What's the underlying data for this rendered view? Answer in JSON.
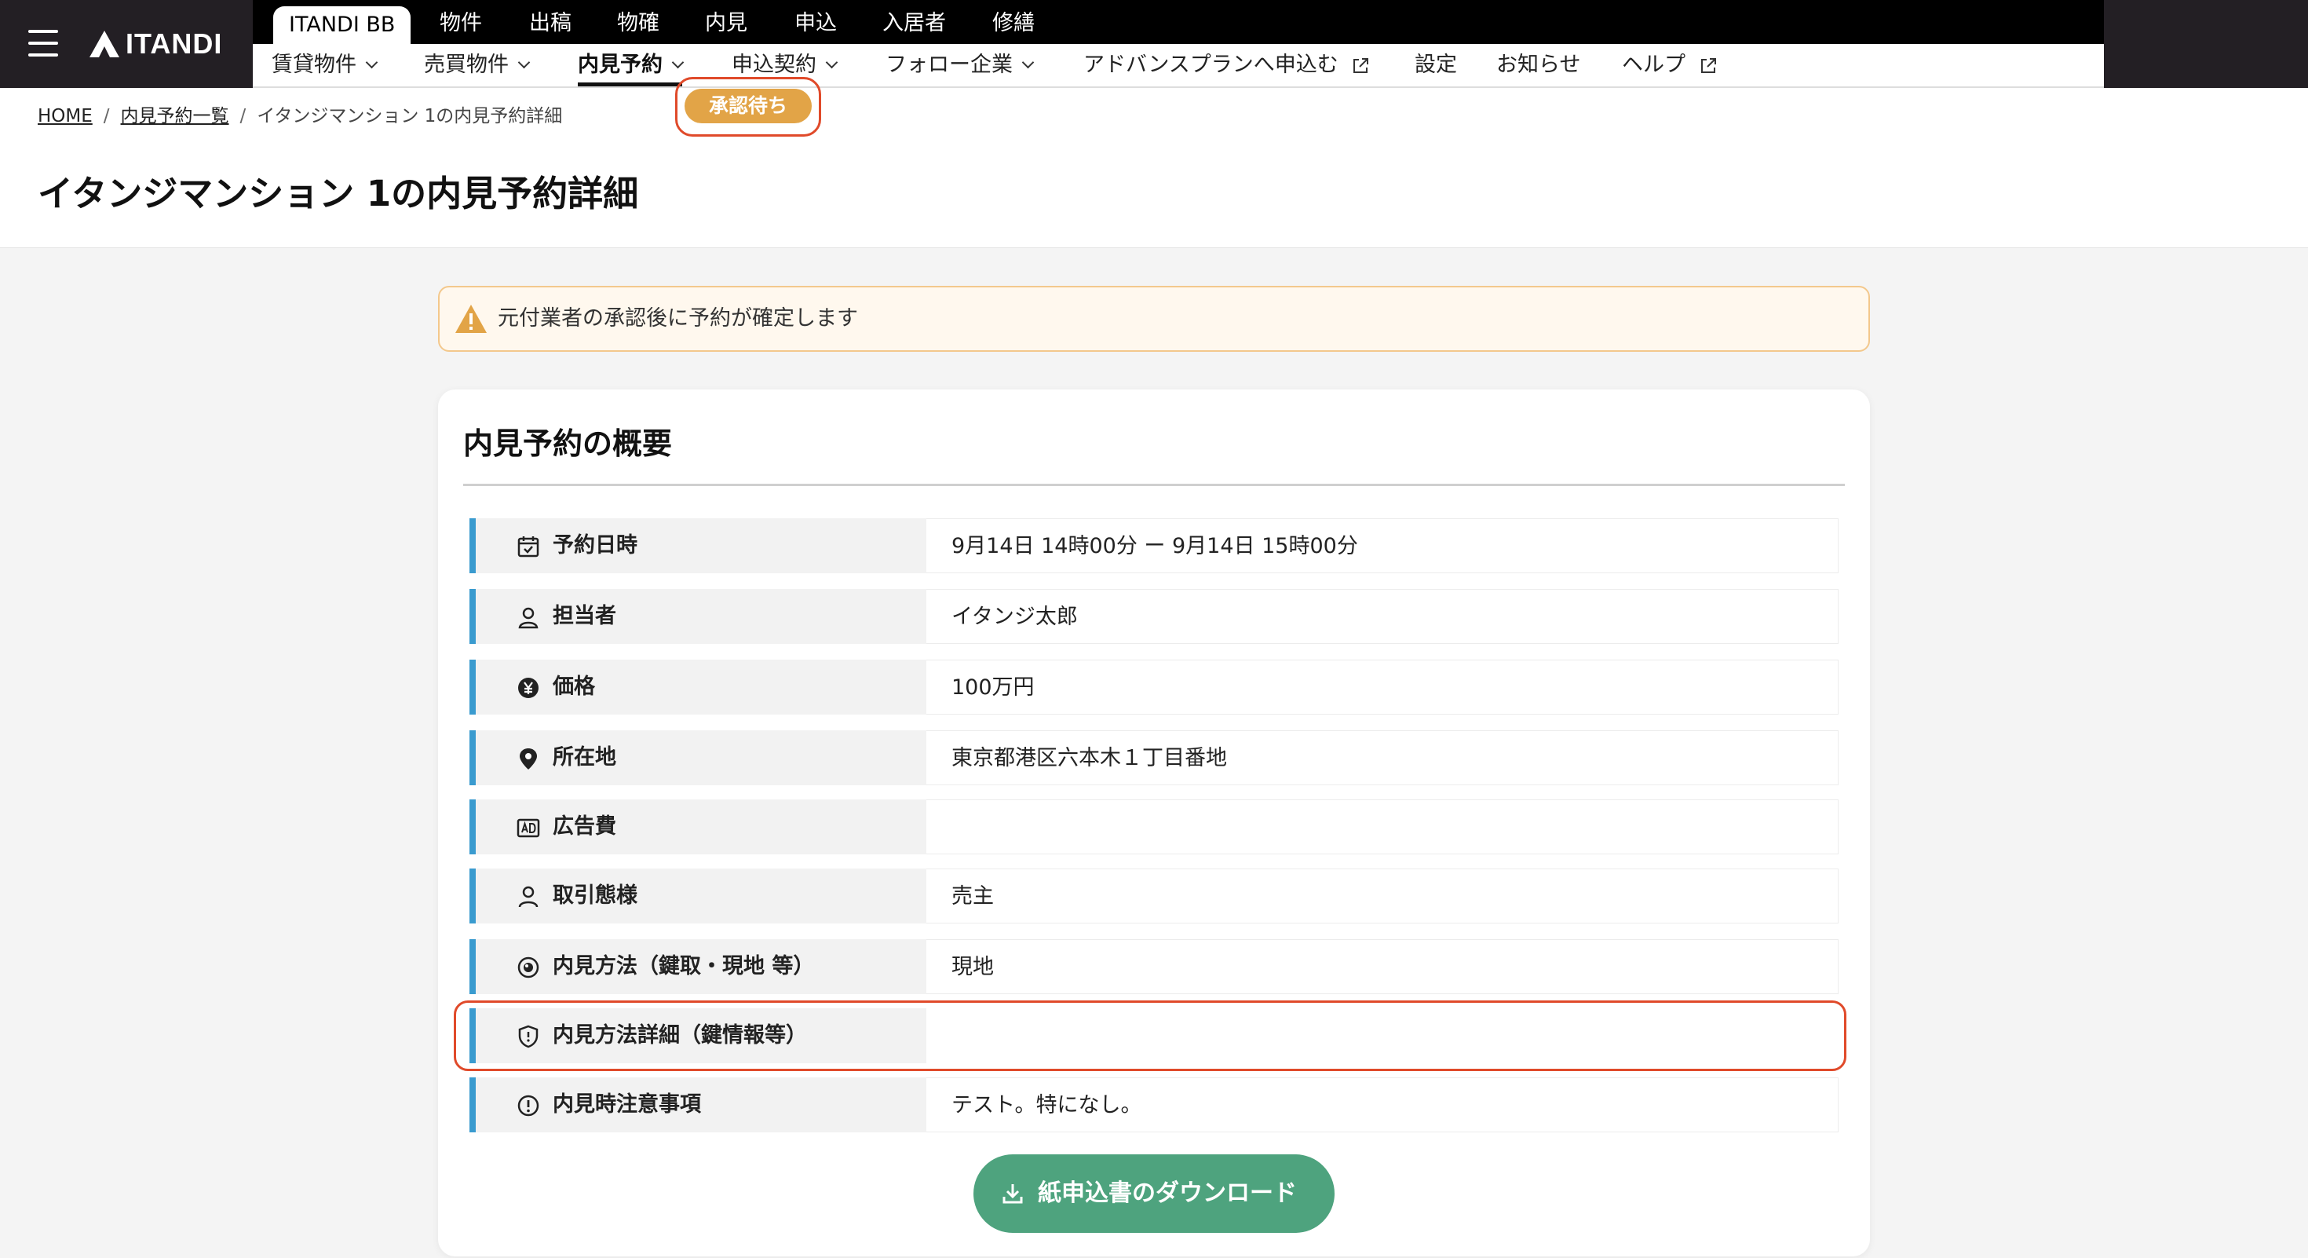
{
  "header": {
    "logo_text": "ITANDI",
    "top_tabs": [
      "ITANDI BB",
      "物件",
      "出稿",
      "物確",
      "内見",
      "申込",
      "入居者",
      "修繕"
    ],
    "sub_nav": [
      {
        "label": "賃貸物件"
      },
      {
        "label": "売買物件"
      },
      {
        "label": "内見予約"
      },
      {
        "label": "申込契約"
      },
      {
        "label": "フォロー企業"
      },
      {
        "label": "アドバンスプランへ申込む"
      },
      {
        "label": "設定"
      },
      {
        "label": "お知らせ"
      },
      {
        "label": "ヘルプ"
      }
    ]
  },
  "breadcrumb": {
    "home": "HOME",
    "list": "内見予約一覧",
    "current": "イタンジマンション 1の内見予約詳細",
    "separator": "/"
  },
  "page": {
    "title": "イタンジマンション 1の内見予約詳細",
    "status_badge": "承認待ち",
    "status_color": "#e2a447"
  },
  "alert": {
    "text": "元付業者の承認後に予約が確定します"
  },
  "summary": {
    "title": "内見予約の概要",
    "rows": [
      {
        "icon": "calendar-icon",
        "label": "予約日時",
        "value": "9月14日 14時00分 ー 9月14日 15時00分"
      },
      {
        "icon": "person-icon",
        "label": "担当者",
        "value": "イタンジ太郎"
      },
      {
        "icon": "yen-icon",
        "label": "価格",
        "value": "100万円"
      },
      {
        "icon": "location-pin-icon",
        "label": "所在地",
        "value": "東京都港区六本木１丁目番地"
      },
      {
        "icon": "ad-icon",
        "label": "広告費",
        "value": ""
      },
      {
        "icon": "user-icon",
        "label": "取引態様",
        "value": "売主"
      },
      {
        "icon": "eye-icon",
        "label": "内見方法（鍵取・現地 等）",
        "value": "現地"
      },
      {
        "icon": "shield-icon",
        "label": "内見方法詳細（鍵情報等）",
        "value": ""
      },
      {
        "icon": "alert-circle-icon",
        "label": "内見時注意事項",
        "value": "テスト。特になし。"
      }
    ],
    "download_button": "紙申込書のダウンロード"
  },
  "colors": {
    "accent_blue": "#3a9bcf",
    "button_green": "#4ea37e",
    "highlight_red": "#e04a2a"
  }
}
